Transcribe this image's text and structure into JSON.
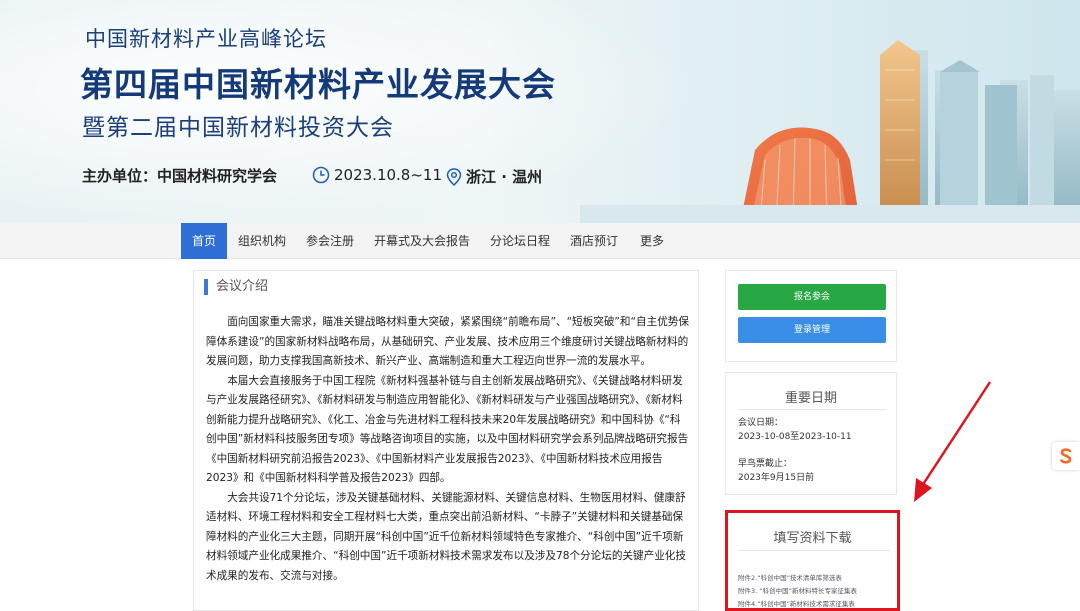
{
  "banner": {
    "subtitle_top": "中国新材料产业高峰论坛",
    "main_title": "第四届中国新材料产业发展大会",
    "second_title": "暨第二届中国新材料投资大会",
    "organizer": "主办单位：中国材料研究学会",
    "date": "2023.10.8~11",
    "location": "浙江 · 温州"
  },
  "nav": {
    "items": [
      "首页",
      "组织机构",
      "参会注册",
      "开幕式及大会报告",
      "分论坛日程",
      "酒店预订",
      "更多"
    ]
  },
  "intro": {
    "section_title": "会议介绍",
    "paragraphs": [
      "面向国家重大需求，瞄准关键战略材料重大突破，紧紧围绕“前瞻布局”、“短板突破”和“自主优势保障体系建设”的国家新材料战略布局，从基础研究、产业发展、技术应用三个维度研讨关键战略新材料的发展问题，助力支撑我国高新技术、新兴产业、高端制造和重大工程迈向世界一流的发展水平。",
      "本届大会直接服务于中国工程院《新材料强基补链与自主创新发展战略研究》、《关键战略材料研发与产业发展路径研究》、《新材料研发与制造应用智能化》、《新材料研发与产业强国战略研究》、《新材料创新能力提升战略研究》、《化工、冶金与先进材料工程科技未来20年发展战略研究》和中国科协《“科创中国”新材料科技服务团专项》等战略咨询项目的实施，以及中国材料研究学会系列品牌战略研究报告《中国新材料研究前沿报告2023》、《中国新材料产业发展报告2023》、《中国新材料技术应用报告2023》和《中国新材料科学普及报告2023》四部。",
      "大会共设71个分论坛，涉及关键基础材料、关键能源材料、关键信息材料、生物医用材料、健康舒适材料、环境工程材料和安全工程材料七大类，重点突出前沿新材料、“卡脖子”关键材料和关键基础保障材料的产业化三大主题，同期开展“科创中国”近千位新材料领域特色专家推介、“科创中国”近千项新材料领域产业化成果推介、“科创中国”近千项新材料技术需求发布以及涉及78个分论坛的关键产业化技术成果的发布、交流与对接。"
    ]
  },
  "sidebar": {
    "register_label": "报名参会",
    "login_label": "登录管理",
    "dates_title": "重要日期",
    "meeting_date_label": "会议日期：",
    "meeting_date_value": "2023-10-08至2023-10-11",
    "early_bird_label": "早鸟票截止：",
    "early_bird_value": "2023年9月15日前",
    "download_title": "填写资料下载",
    "downloads": [
      "附件2.“科创中国”技术清单库筛选表",
      "附件3. “科创中国”新材料特长专家征集表",
      "附件4.“科创中国”新材料技术需求征集表"
    ]
  },
  "colors": {
    "nav_active": "#2e6fd6",
    "register_button": "#28a745",
    "login_button": "#3a8ee6",
    "highlight": "#e0141f",
    "title_blue": "#153a7a"
  }
}
